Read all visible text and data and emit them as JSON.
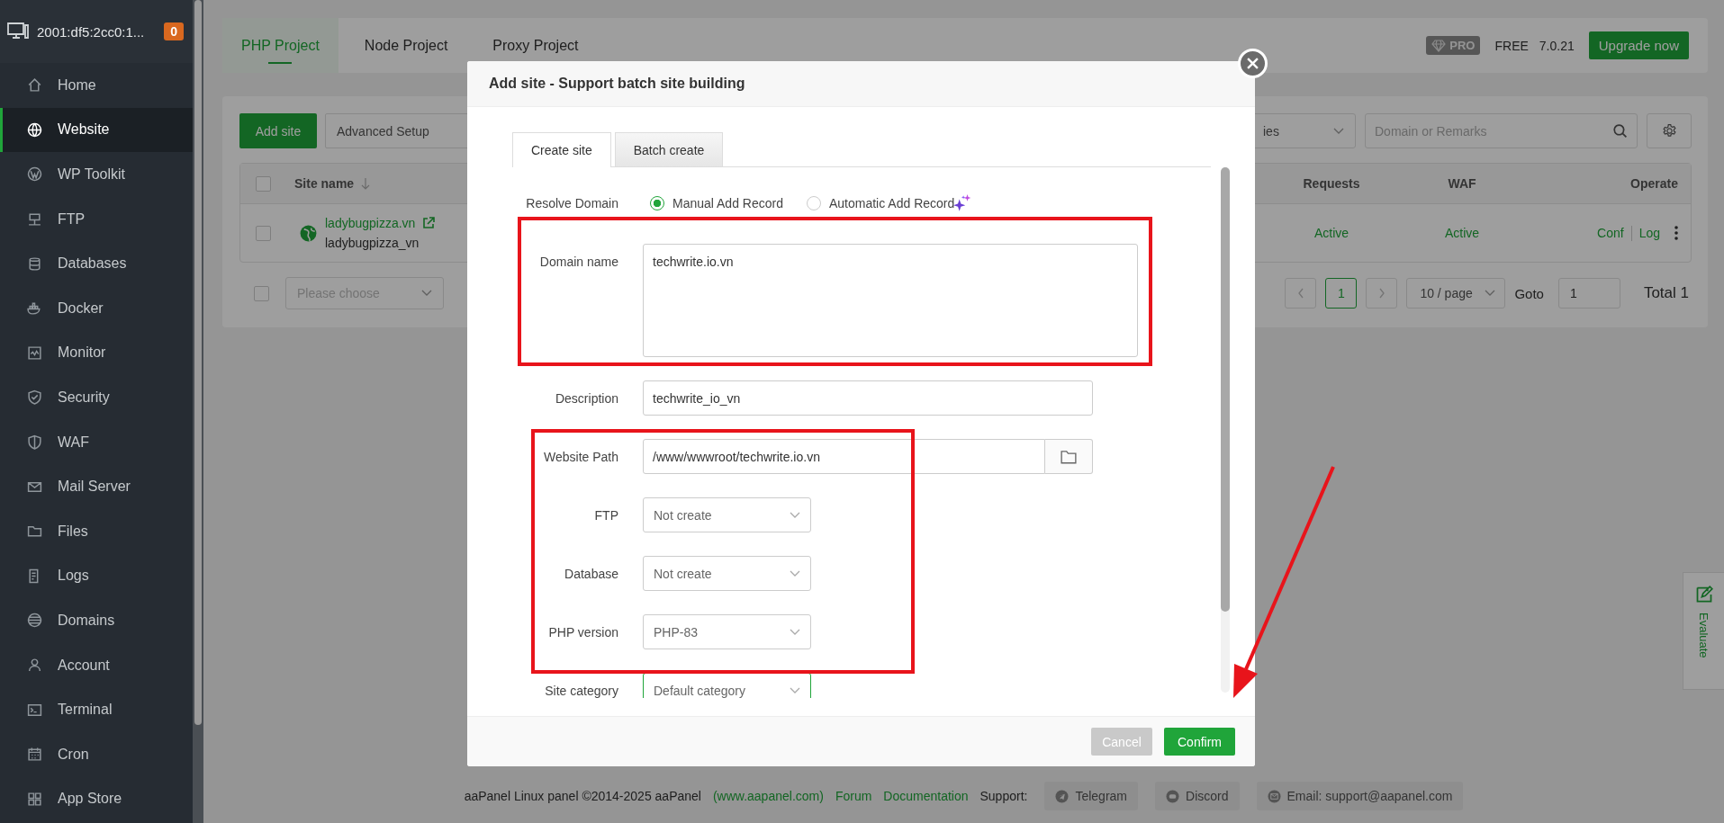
{
  "sidebar": {
    "host": "2001:df5:2cc0:1...",
    "badge": "0",
    "items": [
      {
        "label": "Home",
        "selected": false
      },
      {
        "label": "Website",
        "selected": true
      },
      {
        "label": "WP Toolkit",
        "selected": false
      },
      {
        "label": "FTP",
        "selected": false
      },
      {
        "label": "Databases",
        "selected": false
      },
      {
        "label": "Docker",
        "selected": false
      },
      {
        "label": "Monitor",
        "selected": false
      },
      {
        "label": "Security",
        "selected": false
      },
      {
        "label": "WAF",
        "selected": false
      },
      {
        "label": "Mail Server",
        "selected": false
      },
      {
        "label": "Files",
        "selected": false
      },
      {
        "label": "Logs",
        "selected": false
      },
      {
        "label": "Domains",
        "selected": false
      },
      {
        "label": "Account",
        "selected": false
      },
      {
        "label": "Terminal",
        "selected": false
      },
      {
        "label": "Cron",
        "selected": false
      },
      {
        "label": "App Store",
        "selected": false
      }
    ]
  },
  "project_tabs": [
    {
      "label": "PHP Project",
      "selected": true
    },
    {
      "label": "Node Project",
      "selected": false
    },
    {
      "label": "Proxy Project",
      "selected": false
    }
  ],
  "header_right": {
    "pro": "PRO",
    "edition": "FREE",
    "version": "7.0.21",
    "upgrade": "Upgrade now"
  },
  "toolbar": {
    "add": "Add site",
    "advanced": "Advanced Setup",
    "category_select": "ies",
    "search": {
      "placeholder": "Domain or Remarks"
    }
  },
  "table": {
    "select_all_checked": false,
    "columns": [
      "Site name",
      "Requests",
      "WAF",
      "Operate"
    ],
    "rows": [
      {
        "checked": false,
        "name": "ladybugpizza.vn",
        "remark": "ladybugpizza_vn",
        "requests": "Active",
        "waf": "Active",
        "actions": [
          "Conf",
          "Log"
        ]
      }
    ]
  },
  "bulk": {
    "checked": false,
    "placeholder": "Please choose"
  },
  "pagination": {
    "pages": [
      {
        "label": "1",
        "selected": true
      }
    ],
    "page_size": "10 / page",
    "goto_label": "Goto",
    "goto_value": "1",
    "total": "Total 1"
  },
  "footer": {
    "copyright": "aaPanel Linux panel ©2014-2025 aaPanel",
    "links": [
      "(www.aapanel.com)",
      "Forum",
      "Documentation"
    ],
    "support_label": "Support:",
    "support": [
      {
        "label": "Telegram",
        "kind": "telegram"
      },
      {
        "label": "Discord",
        "kind": "discord"
      },
      {
        "label": "Email: support@aapanel.com",
        "kind": "email"
      }
    ]
  },
  "evaluate": "Evaluate",
  "dialog": {
    "title": "Add site - Support batch site building",
    "tabs": [
      {
        "label": "Create site",
        "selected": true
      },
      {
        "label": "Batch create",
        "selected": false
      }
    ],
    "resolve": {
      "label": "Resolve Domain",
      "options": [
        {
          "label": "Manual Add Record",
          "selected": true
        },
        {
          "label": "Automatic Add Record",
          "selected": false
        }
      ]
    },
    "fields": [
      {
        "kind": "textarea",
        "label": "Domain name",
        "value": "techwrite.io.vn"
      },
      {
        "kind": "input",
        "label": "Description",
        "value": "techwrite_io_vn"
      },
      {
        "kind": "path",
        "label": "Website Path",
        "value": "/www/wwwroot/techwrite.io.vn"
      },
      {
        "kind": "select",
        "label": "FTP",
        "value": "Not create",
        "focused": false
      },
      {
        "kind": "select",
        "label": "Database",
        "value": "Not create",
        "focused": false
      },
      {
        "kind": "select",
        "label": "PHP version",
        "value": "PHP-83",
        "focused": false
      },
      {
        "kind": "select",
        "label": "Site category",
        "value": "Default category",
        "focused": true
      }
    ],
    "buttons": [
      {
        "label": "Cancel",
        "kind": "secondary"
      },
      {
        "label": "Confirm",
        "kind": "primary"
      }
    ]
  }
}
